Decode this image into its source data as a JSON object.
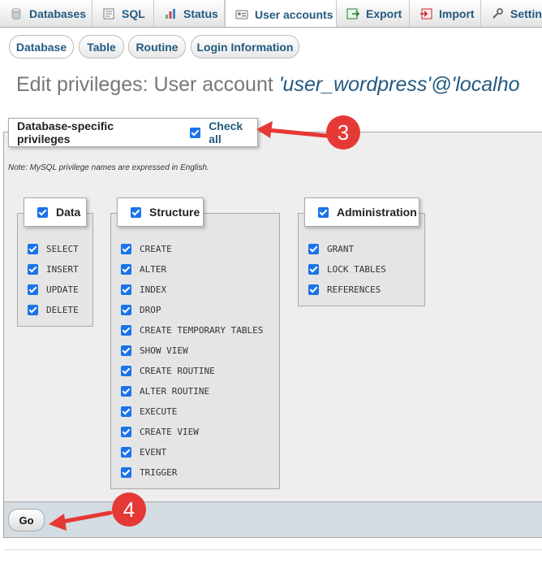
{
  "top_tabs": [
    {
      "label": "Databases",
      "icon": "database-icon"
    },
    {
      "label": "SQL",
      "icon": "sql-icon"
    },
    {
      "label": "Status",
      "icon": "status-icon"
    },
    {
      "label": "User accounts",
      "icon": "user-accounts-icon",
      "active": true
    },
    {
      "label": "Export",
      "icon": "export-icon"
    },
    {
      "label": "Import",
      "icon": "import-icon"
    },
    {
      "label": "Settin",
      "icon": "wrench-icon"
    }
  ],
  "sub_tabs": [
    "Database",
    "Table",
    "Routine",
    "Login Information"
  ],
  "heading": {
    "prefix": "Edit privileges: User account ",
    "account": "'user_wordpress'@'localho"
  },
  "privileges": {
    "legend": "Database-specific privileges",
    "check_all_label": "Check all",
    "check_all_checked": true,
    "note": "Note: MySQL privilege names are expressed in English.",
    "groups": [
      {
        "name": "Data",
        "checked": true,
        "items": [
          "SELECT",
          "INSERT",
          "UPDATE",
          "DELETE"
        ]
      },
      {
        "name": "Structure",
        "checked": true,
        "items": [
          "CREATE",
          "ALTER",
          "INDEX",
          "DROP",
          "CREATE TEMPORARY TABLES",
          "SHOW VIEW",
          "CREATE ROUTINE",
          "ALTER ROUTINE",
          "EXECUTE",
          "CREATE VIEW",
          "EVENT",
          "TRIGGER"
        ]
      },
      {
        "name": "Administration",
        "checked": true,
        "items": [
          "GRANT",
          "LOCK TABLES",
          "REFERENCES"
        ]
      }
    ]
  },
  "footer": {
    "go_label": "Go"
  },
  "annotations": {
    "step_check_all": "3",
    "step_go": "4",
    "color": "#e53935"
  }
}
